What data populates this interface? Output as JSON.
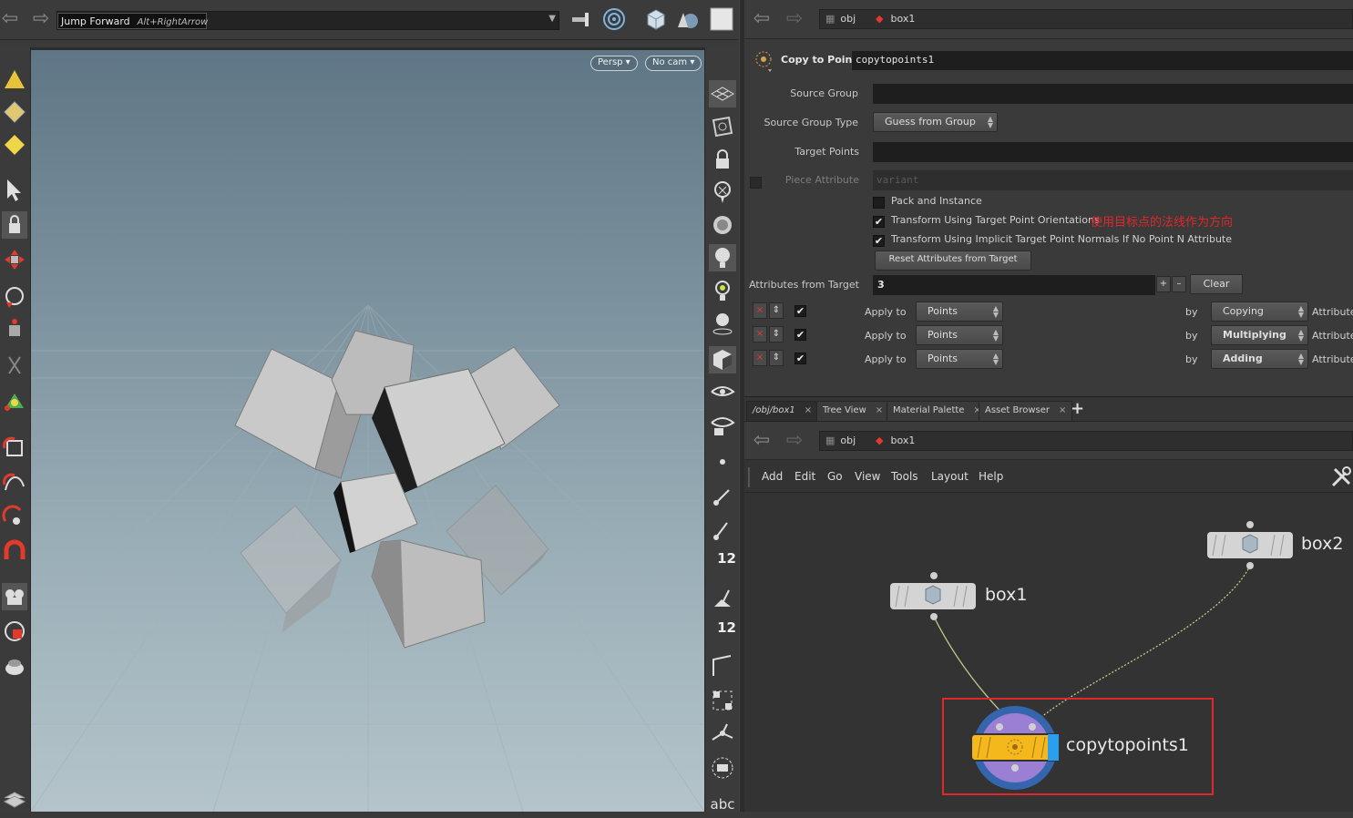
{
  "left_toolbar": {
    "jump_forward_label": "Jump Forward",
    "jump_forward_shortcut": "Alt+RightArrow"
  },
  "viewport": {
    "persp_label": "Persp",
    "cam_label": "No cam",
    "tools_bottom_label": "abc",
    "snap_count_a": "12",
    "snap_count_b": "12"
  },
  "param_path": {
    "obj": "obj",
    "node": "box1"
  },
  "node": {
    "type_label": "Copy to Points",
    "name": "copytopoints1"
  },
  "params": {
    "source_group_label": "Source Group",
    "source_group_type_label": "Source Group Type",
    "source_group_type_value": "Guess from Group",
    "target_points_label": "Target Points",
    "piece_attribute_label": "Piece Attribute",
    "piece_attribute_placeholder": "variant",
    "pack_and_instance_label": "Pack and Instance",
    "transform_orient_label": "Transform Using Target Point Orientations",
    "transform_orient_note": "使用目标点的法线作为方向",
    "transform_normals_label": "Transform Using Implicit Target Point Normals If No Point N Attribute",
    "reset_button": "Reset Attributes from Target",
    "attrs_from_target_label": "Attributes from Target",
    "attrs_from_target_count": "3",
    "clear_button": "Clear",
    "rows": [
      {
        "apply_to_label": "Apply to",
        "apply_to_value": "Points",
        "by_label": "by",
        "mode": "Copying",
        "attribute_label": "Attribute"
      },
      {
        "apply_to_label": "Apply to",
        "apply_to_value": "Points",
        "by_label": "by",
        "mode": "Multiplying",
        "attribute_label": "Attribute"
      },
      {
        "apply_to_label": "Apply to",
        "apply_to_value": "Points",
        "by_label": "by",
        "mode": "Adding",
        "attribute_label": "Attribute"
      }
    ]
  },
  "tabs": [
    {
      "label": "/obj/box1"
    },
    {
      "label": "Tree View"
    },
    {
      "label": "Material Palette"
    },
    {
      "label": "Asset Browser"
    }
  ],
  "tab_close": "×",
  "tab_add": "+",
  "network_path": {
    "obj": "obj",
    "node": "box1"
  },
  "network_menu": [
    "Add",
    "Edit",
    "Go",
    "View",
    "Tools",
    "Layout",
    "Help"
  ],
  "network_nodes": {
    "box1": "box1",
    "box2": "box2",
    "copy": "copytopoints1"
  },
  "colors": {
    "highlight_red": "#e0282a",
    "node_orange": "#f5b81c",
    "node_blue": "#2b9ef0"
  }
}
